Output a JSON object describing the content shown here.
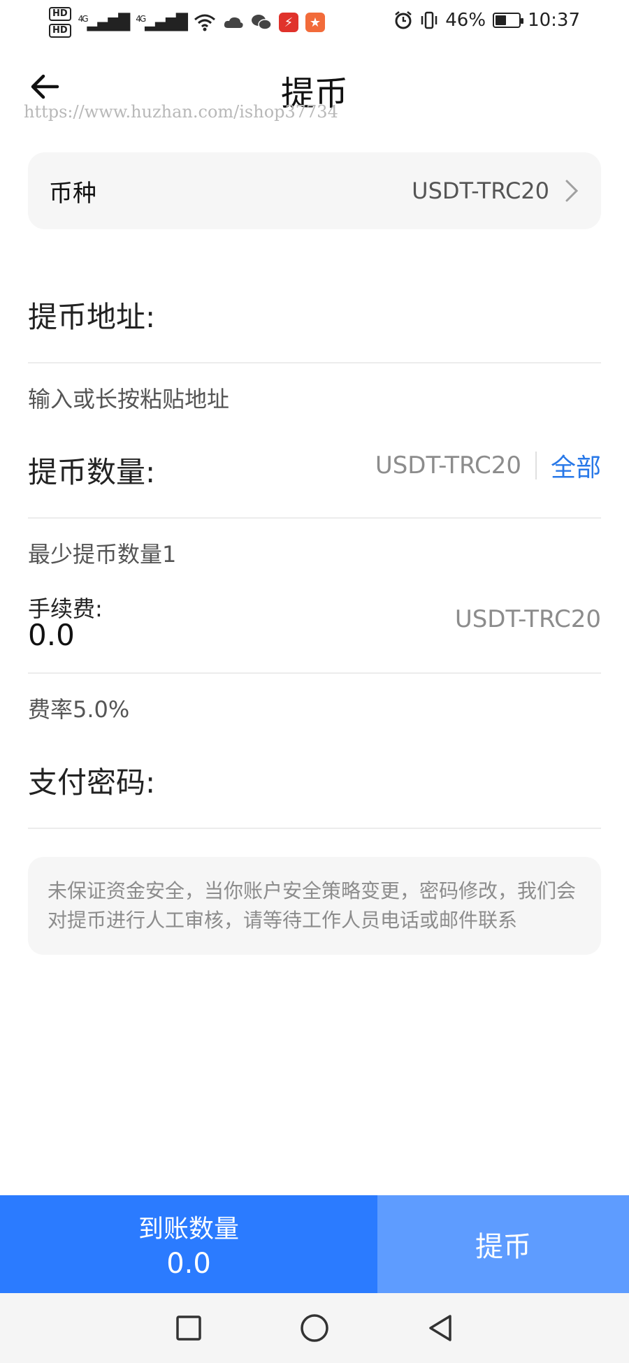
{
  "status_bar": {
    "hd1": "HD",
    "hd2": "HD",
    "net1": "4G",
    "net2": "4G",
    "battery_percent": "46%",
    "battery_level": 0.46,
    "time": "10:37"
  },
  "header": {
    "title": "提币",
    "watermark": "https://www.huzhan.com/ishop37734"
  },
  "currency": {
    "label": "币种",
    "value": "USDT-TRC20"
  },
  "address": {
    "label": "提币地址:",
    "placeholder": "输入或长按粘贴地址"
  },
  "amount": {
    "label": "提币数量:",
    "unit": "USDT-TRC20",
    "all_label": "全部",
    "min_hint": "最少提币数量1"
  },
  "fee": {
    "label": "手续费:",
    "value": "0.0",
    "unit": "USDT-TRC20",
    "rate_hint": "费率5.0%"
  },
  "password": {
    "label": "支付密码:"
  },
  "notice": {
    "text": "未保证资金安全，当你账户安全策略变更，密码修改，我们会对提币进行人工审核，请等待工作人员电话或邮件联系"
  },
  "bottom": {
    "receive_label": "到账数量",
    "receive_value": "0.0",
    "submit_label": "提币"
  },
  "colors": {
    "primary": "#2b7bff",
    "primary_light": "#5e9cff",
    "link": "#2878e8"
  }
}
